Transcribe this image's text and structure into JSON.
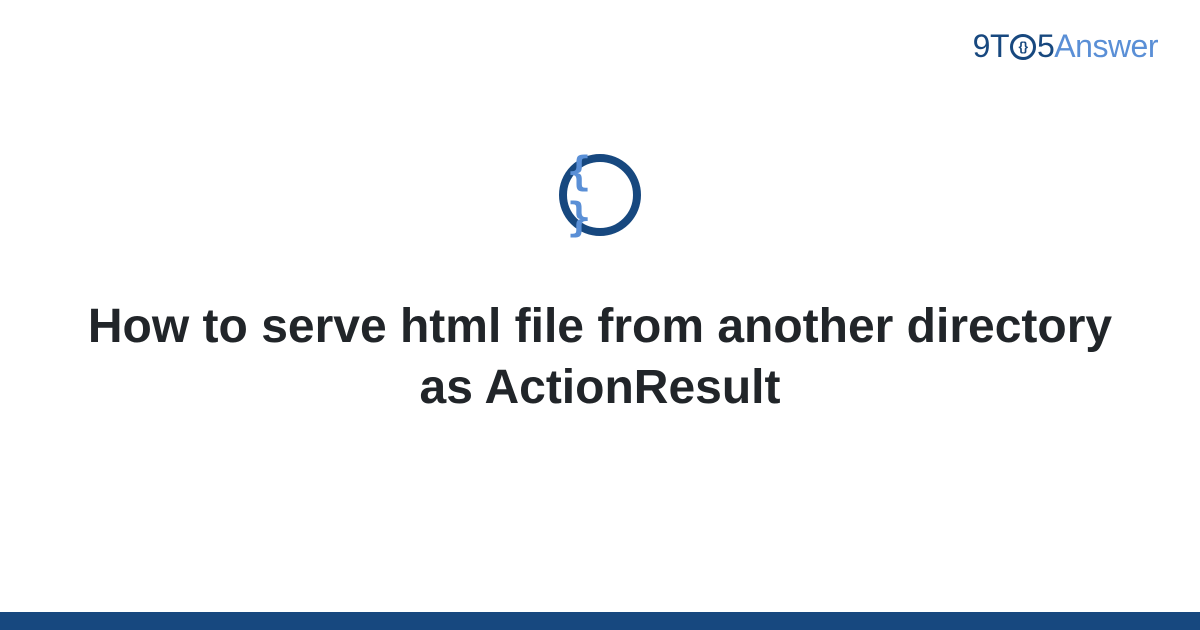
{
  "logo": {
    "part1": "9T",
    "circle_inner": "{}",
    "part2": "5",
    "part3": "Answer"
  },
  "icon": {
    "braces": "{ }"
  },
  "title": "How to serve html file from another directory as ActionResult",
  "colors": {
    "primary": "#17487f",
    "secondary": "#5a8fd6",
    "text": "#212529"
  }
}
